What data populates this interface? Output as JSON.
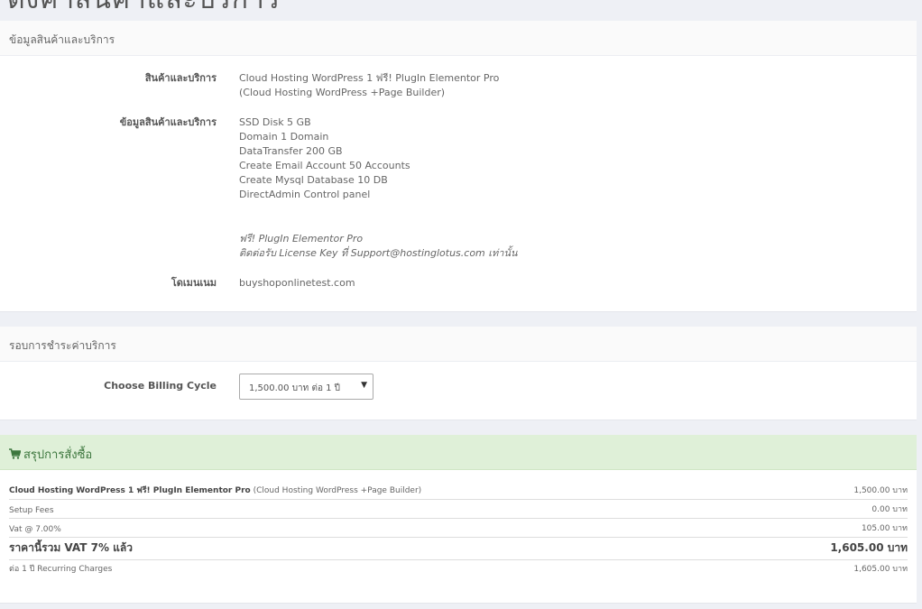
{
  "page": {
    "title": "ตั้งค่าสินค้าและบริการ"
  },
  "product_panel": {
    "heading": "ข้อมูลสินค้าและบริการ",
    "product_label": "สินค้าและบริการ",
    "product_name": "Cloud Hosting WordPress 1 ฟรี! PlugIn Elementor Pro",
    "product_group": "(Cloud Hosting WordPress +Page Builder)",
    "details_label": "ข้อมูลสินค้าและบริการ",
    "details": [
      "SSD Disk 5 GB",
      "Domain 1 Domain",
      "DataTransfer 200 GB",
      "Create Email Account 50 Accounts",
      "Create Mysql Database 10 DB",
      "DirectAdmin Control panel"
    ],
    "promo_lines": [
      "ฟรี! PlugIn Elementor Pro",
      "ติดต่อรับ License Key ที่ Support@hostinglotus.com เท่านั้น"
    ],
    "domain_label": "โดเมนเนม",
    "domain_value": "buyshoponlinetest.com"
  },
  "billing_panel": {
    "heading": "รอบการชำระค่าบริการ",
    "cycle_label": "Choose Billing Cycle",
    "cycle_selected": "1,500.00 บาท ต่อ 1 ปี",
    "dropdown_icon": "caret-down-icon"
  },
  "summary_panel": {
    "heading": "สรุปการสั่งซื้อ",
    "icon": "shopping-cart-icon",
    "accent_color": "#3c763d",
    "background_color": "#dff0d8",
    "item_name": "Cloud Hosting WordPress 1 ฟรี! PlugIn Elementor Pro",
    "item_group": "(Cloud Hosting WordPress +Page Builder)",
    "item_price": "1,500.00 บาท",
    "setup_label": "Setup Fees",
    "setup_value": "0.00 บาท",
    "vat_label": "Vat @ 7.00%",
    "vat_value": "105.00 บาท",
    "total_label": "ราคานี้รวม VAT 7% แล้ว",
    "total_value": "1,605.00 บาท",
    "recurring_label": "ต่อ 1 ปี Recurring Charges",
    "recurring_value": "1,605.00 บาท"
  }
}
